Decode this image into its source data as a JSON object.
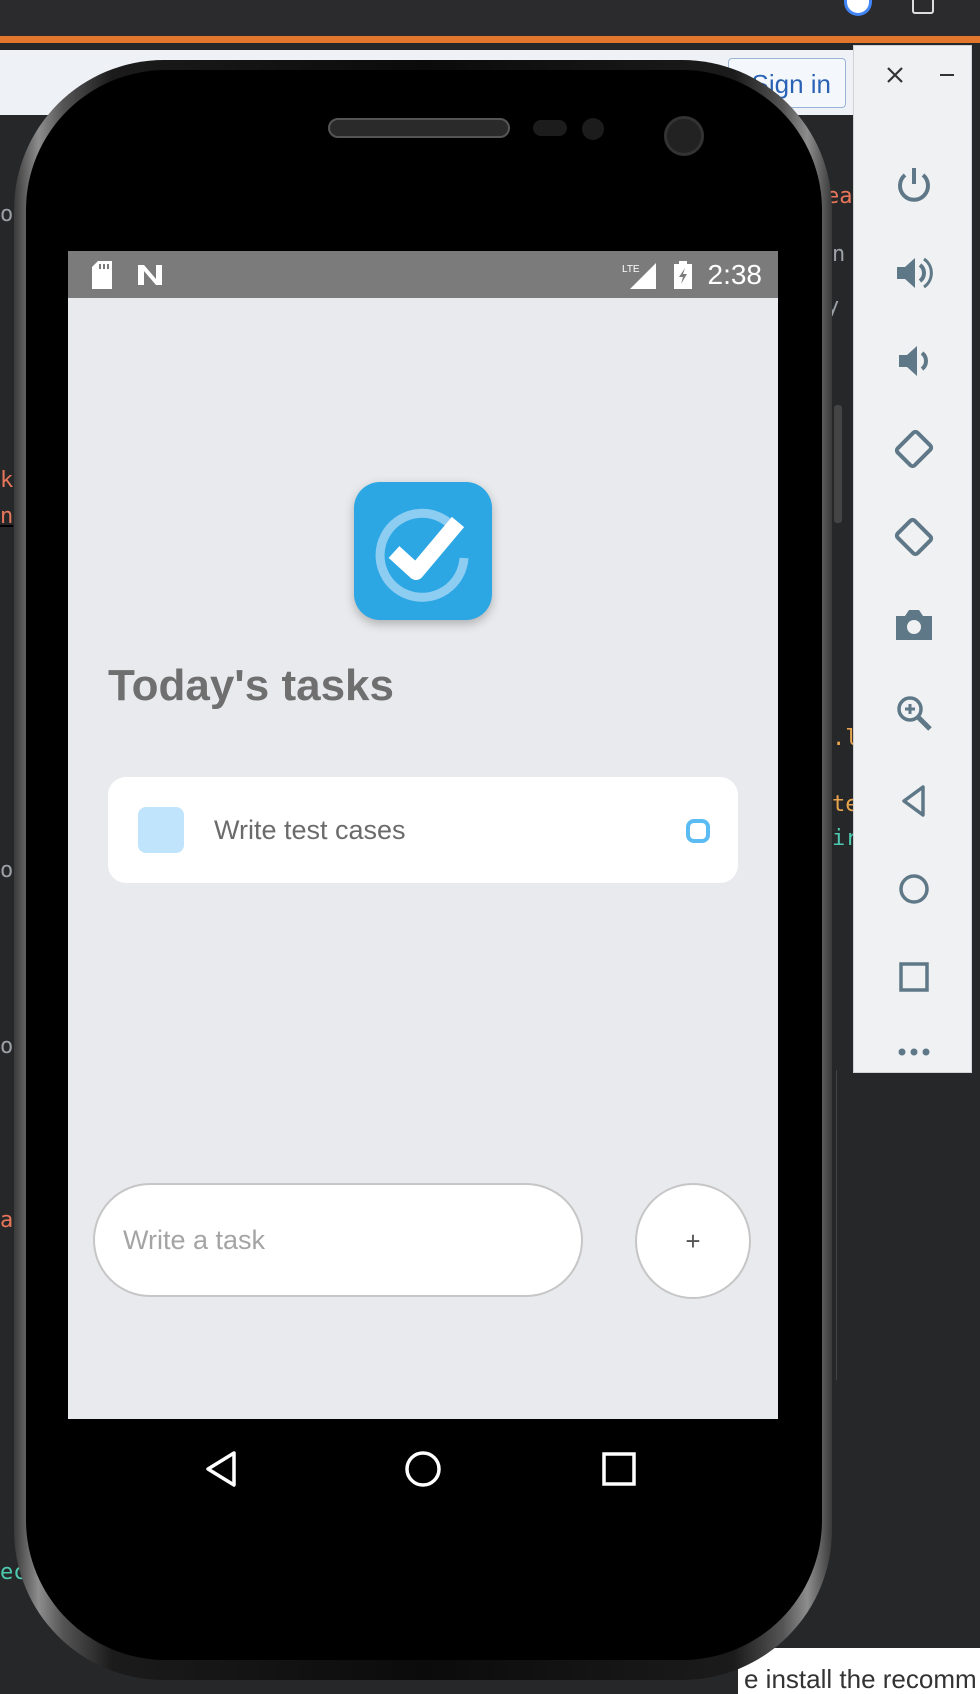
{
  "browser": {
    "sign_in_label": "Sign in",
    "bottom_text": "e install the recomm"
  },
  "code_fragments": [
    {
      "text": "or",
      "color": "#9aa0a6"
    },
    {
      "text": "ea",
      "color": "#e8765a"
    },
    {
      "text": "n",
      "color": "#9aa0a6"
    },
    {
      "text": "y c",
      "color": "#9aa0a6"
    },
    {
      "text": "k",
      "color": "#e8765a"
    },
    {
      "text": "n",
      "color": "#e8765a"
    },
    {
      "text": ".l",
      "color": "#e8a54d"
    },
    {
      "text": "te",
      "color": "#e8a54d"
    },
    {
      "text": "ir",
      "color": "#4ec9b0"
    },
    {
      "text": "o",
      "color": "#9aa0a6"
    },
    {
      "text": "o",
      "color": "#9aa0a6"
    },
    {
      "text": "a",
      "color": "#e8765a"
    },
    {
      "text": "ec",
      "color": "#4ec9b0"
    }
  ],
  "emulator_toolbar": {
    "icons": [
      "power-icon",
      "volume-up-icon",
      "volume-down-icon",
      "rotate-left-icon",
      "rotate-right-icon",
      "camera-icon",
      "zoom-icon",
      "back-icon",
      "home-icon",
      "overview-icon",
      "more-icon"
    ]
  },
  "status_bar": {
    "time": "2:38",
    "network": "LTE"
  },
  "app": {
    "title": "Today's tasks",
    "tasks": [
      {
        "text": "Write test cases"
      }
    ],
    "input_placeholder": "Write a task",
    "add_button_label": "+"
  },
  "colors": {
    "logo_blue": "#2ca7e4",
    "task_square": "#bfe4fb",
    "task_circle": "#5bbcf4",
    "screen_bg": "#e8eaed",
    "toolbar_icon": "#5f7888"
  }
}
